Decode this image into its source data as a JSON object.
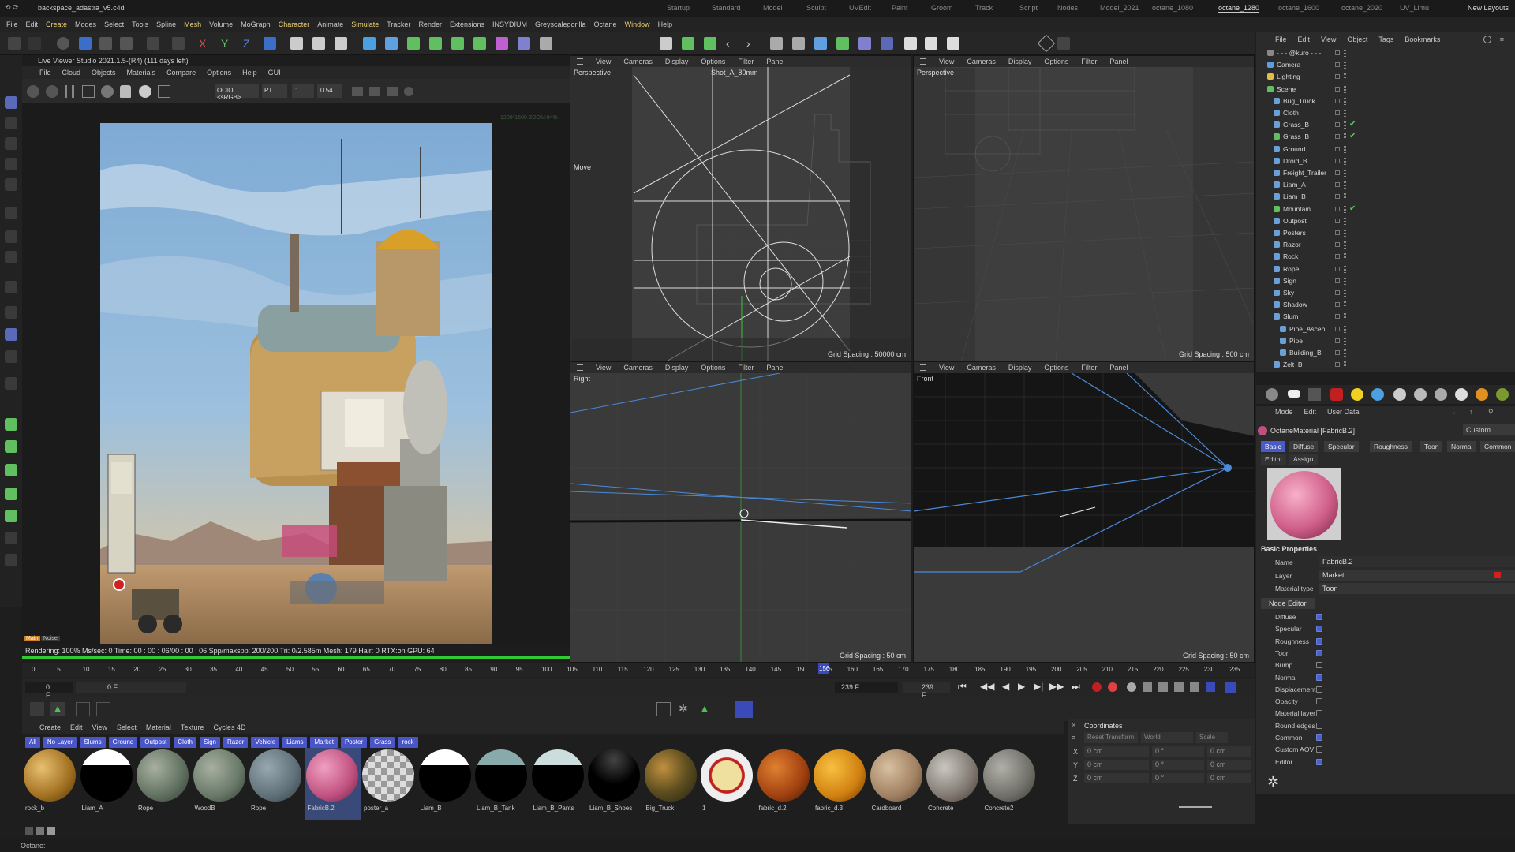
{
  "app": {
    "file_title": "backspace_adastra_v5.c4d",
    "new_layouts": "New Layouts"
  },
  "layouts": [
    "Startup",
    "Standard",
    "Model",
    "Sculpt",
    "UVEdit",
    "Paint",
    "Groom",
    "Track",
    "Script",
    "Nodes",
    "Model_2021",
    "octane_1080",
    "octane_1280",
    "octane_1600",
    "octane_2020",
    "UV_Limu"
  ],
  "menubar": [
    "File",
    "Edit",
    "Create",
    "Modes",
    "Select",
    "Tools",
    "Spline",
    "Mesh",
    "Volume",
    "MoGraph",
    "Character",
    "Animate",
    "Simulate",
    "Tracker",
    "Render",
    "Extensions",
    "INSYDIUM",
    "Greyscalegorilla",
    "Octane",
    "Window",
    "Help"
  ],
  "live_viewer": {
    "title": "Live Viewer Studio 2021.1.5-(R4) (111 days left)",
    "menu": [
      "File",
      "Cloud",
      "Objects",
      "Materials",
      "Compare",
      "Options",
      "Help",
      "GUI"
    ],
    "ocio": "OCIO:<sRGB>",
    "pt": "PT",
    "field1": "1",
    "field2": "0.54",
    "res_note": "1200*1600 ZOOM:94%",
    "main_btn": "Main",
    "noise_btn": "Noise",
    "status": "Rendering: 100%  Ms/sec: 0    Time: 00 : 00 : 06/00 : 00 : 06    Spp/maxspp: 200/200    Tri: 0/2.585m    Mesh: 179    Hair: 0    RTX:on         GPU:      64"
  },
  "viewports": {
    "menu": [
      "View",
      "Cameras",
      "Display",
      "Options",
      "Filter",
      "Panel"
    ],
    "tl": {
      "label": "Perspective",
      "camera": "Shot_A_80mm",
      "grid": "Grid Spacing : 50000 cm",
      "move": "Move"
    },
    "tr": {
      "label": "Perspective",
      "grid": "Grid Spacing : 500 cm"
    },
    "bl": {
      "label": "Right",
      "grid": "Grid Spacing : 50 cm"
    },
    "br": {
      "label": "Front",
      "grid": "Grid Spacing : 50 cm"
    }
  },
  "object_manager": {
    "menu": [
      "File",
      "Edit",
      "View",
      "Object",
      "Tags",
      "Bookmarks"
    ],
    "items": [
      {
        "name": "- - - @kuro - - -",
        "color": "#888888",
        "indent": 0
      },
      {
        "name": "Camera",
        "color": "#5aa0e0",
        "indent": 0
      },
      {
        "name": "Lighting",
        "color": "#e0c040",
        "indent": 0
      },
      {
        "name": "Scene",
        "color": "#60c060",
        "indent": 0
      },
      {
        "name": "Bug_Truck",
        "color": "#6aa0d8",
        "indent": 1
      },
      {
        "name": "Cloth",
        "color": "#6aa0d8",
        "indent": 1
      },
      {
        "name": "Grass_B",
        "color": "#6aa0d8",
        "indent": 1,
        "check": true
      },
      {
        "name": "Grass_B",
        "color": "#60c060",
        "indent": 1,
        "check": true
      },
      {
        "name": "Ground",
        "color": "#6aa0d8",
        "indent": 1
      },
      {
        "name": "Droid_B",
        "color": "#6aa0d8",
        "indent": 1
      },
      {
        "name": "Freight_Trailer",
        "color": "#6aa0d8",
        "indent": 1
      },
      {
        "name": "Liam_A",
        "color": "#6aa0d8",
        "indent": 1
      },
      {
        "name": "Liam_B",
        "color": "#6aa0d8",
        "indent": 1
      },
      {
        "name": "Mountain",
        "color": "#60c060",
        "indent": 1,
        "check": true
      },
      {
        "name": "Outpost",
        "color": "#6aa0d8",
        "indent": 1
      },
      {
        "name": "Posters",
        "color": "#6aa0d8",
        "indent": 1
      },
      {
        "name": "Razor",
        "color": "#6aa0d8",
        "indent": 1
      },
      {
        "name": "Rock",
        "color": "#6aa0d8",
        "indent": 1
      },
      {
        "name": "Rope",
        "color": "#6aa0d8",
        "indent": 1
      },
      {
        "name": "Sign",
        "color": "#6aa0d8",
        "indent": 1
      },
      {
        "name": "Sky",
        "color": "#6aa0d8",
        "indent": 1
      },
      {
        "name": "Shadow",
        "color": "#6aa0d8",
        "indent": 1
      },
      {
        "name": "Slum",
        "color": "#6aa0d8",
        "indent": 1
      },
      {
        "name": "Pipe_Ascen",
        "color": "#6aa0d8",
        "indent": 2
      },
      {
        "name": "Pipe",
        "color": "#6aa0d8",
        "indent": 2
      },
      {
        "name": "Building_B",
        "color": "#6aa0d8",
        "indent": 2
      },
      {
        "name": "Zelt_B",
        "color": "#6aa0d8",
        "indent": 1
      }
    ]
  },
  "attributes": {
    "menu": [
      "Mode",
      "Edit",
      "User Data"
    ],
    "material_title": "OctaneMaterial [FabricB.2]",
    "custom": "Custom",
    "tabs": [
      "Basic",
      "Diffuse",
      "Specular",
      "Roughness",
      "Toon",
      "Normal",
      "Common"
    ],
    "subtabs": [
      "Editor",
      "Assign"
    ],
    "section": "Basic Properties",
    "name_label": "Name",
    "name_value": "FabricB.2",
    "layer_label": "Layer",
    "layer_value": "Market",
    "mattype_label": "Material type",
    "mattype_value": "Toon",
    "node_editor": "Node Editor",
    "channels": [
      {
        "label": "Diffuse",
        "on": true
      },
      {
        "label": "Specular",
        "on": true
      },
      {
        "label": "Roughness",
        "on": true
      },
      {
        "label": "Toon",
        "on": true
      },
      {
        "label": "Bump",
        "on": false
      },
      {
        "label": "Normal",
        "on": true
      },
      {
        "label": "Displacement",
        "on": false
      },
      {
        "label": "Opacity",
        "on": false
      },
      {
        "label": "Material layer",
        "on": false
      },
      {
        "label": "Round edges",
        "on": false
      },
      {
        "label": "Common",
        "on": true
      },
      {
        "label": "Custom AOV",
        "on": false
      },
      {
        "label": "Editor",
        "on": true
      }
    ]
  },
  "timeline": {
    "ticks": [
      "0",
      "5",
      "10",
      "15",
      "20",
      "25",
      "30",
      "35",
      "40",
      "45",
      "50",
      "55",
      "60",
      "65",
      "70",
      "75",
      "80",
      "85",
      "90",
      "95",
      "100",
      "105",
      "110",
      "115",
      "120",
      "125",
      "130",
      "135",
      "140",
      "145",
      "150",
      "155",
      "160",
      "165",
      "170",
      "175",
      "180",
      "185",
      "190",
      "195",
      "200",
      "205",
      "210",
      "215",
      "220",
      "225",
      "230",
      "235"
    ],
    "current_frame": "156",
    "start": "0 F",
    "start2": "0 F",
    "end": "239 F",
    "end2": "239 F"
  },
  "material_manager": {
    "menu": [
      "Create",
      "Edit",
      "View",
      "Select",
      "Material",
      "Texture",
      "Cycles 4D"
    ],
    "tags": [
      "All",
      "No Layer",
      "Slums",
      "Ground",
      "Outpost",
      "Cloth",
      "Sign",
      "Razor",
      "Vehicle",
      "Liams",
      "Market",
      "Poster",
      "Grass",
      "rock"
    ],
    "materials": [
      {
        "name": "rock_b",
        "style": "radial-gradient(circle at 35% 35%,#e8c070,#a07020 60%,#4a3010)"
      },
      {
        "name": "Liam_A",
        "style": "linear-gradient(#fff 0 30%,#000 30%)"
      },
      {
        "name": "Rope",
        "style": "radial-gradient(circle at 35% 35%,#a8b0a0,#607060 60%,#303830)"
      },
      {
        "name": "WoodB",
        "style": "radial-gradient(circle at 35% 35%,#a8b0a0,#687868 60%,#303830)"
      },
      {
        "name": "Rope",
        "style": "radial-gradient(circle at 35% 35%,#98a8b0,#607078 60%,#303840)"
      },
      {
        "name": "FabricB.2",
        "style": "radial-gradient(circle at 35% 35%,#f0a0c0,#c05080 60%,#602040)"
      },
      {
        "name": "poster_a",
        "style": "repeating-conic-gradient(#ddd 0 25%,#999 0 50%) 0 0/16px 16px"
      },
      {
        "name": "Liam_B",
        "style": "linear-gradient(#fff 0 30%,#000 30%)"
      },
      {
        "name": "Liam_B_Tank",
        "style": "linear-gradient(#8aa 0 30%,#000 30%)"
      },
      {
        "name": "Liam_B_Pants",
        "style": "linear-gradient(#cdd 0 30%,#000 30%)"
      },
      {
        "name": "Liam_B_Shoes",
        "style": "radial-gradient(circle at 50% 20%,#444,#000 50%)"
      },
      {
        "name": "Big_Truck",
        "style": "radial-gradient(circle at 35% 35%,#c09040,#605020 50%,#202010)"
      },
      {
        "name": "1",
        "style": "radial-gradient(circle,#f0e0a0 0 40%,#c02020 42% 48%,#eee 50%)"
      },
      {
        "name": "fabric_d.2",
        "style": "radial-gradient(circle at 35% 35%,#e08030,#a04010 60%,#401808)"
      },
      {
        "name": "fabric_d.3",
        "style": "radial-gradient(circle at 35% 35%,#f8c040,#d08010 60%,#603008)"
      },
      {
        "name": "Cardboard",
        "style": "radial-gradient(circle at 35% 35%,#d8c0a0,#a08060 60%,#504030)"
      },
      {
        "name": "Concrete",
        "style": "radial-gradient(circle at 35% 35%,#c8c8c0,#807870 60%,#403830)"
      },
      {
        "name": "Concrete2",
        "style": "radial-gradient(circle at 35% 35%,#b0b0a8,#707068 60%,#383830)"
      }
    ]
  },
  "coordinates": {
    "title": "Coordinates",
    "reset": "Reset Transform",
    "world": "World",
    "scale": "Scale",
    "rows": [
      {
        "axis": "X",
        "pos": "0 cm",
        "rot": "0 °",
        "size": "0 cm"
      },
      {
        "axis": "Y",
        "pos": "0 cm",
        "rot": "0 °",
        "size": "0 cm"
      },
      {
        "axis": "Z",
        "pos": "0 cm",
        "rot": "0 °",
        "size": "0 cm"
      }
    ]
  },
  "statusbar": {
    "text": "Octane:"
  }
}
